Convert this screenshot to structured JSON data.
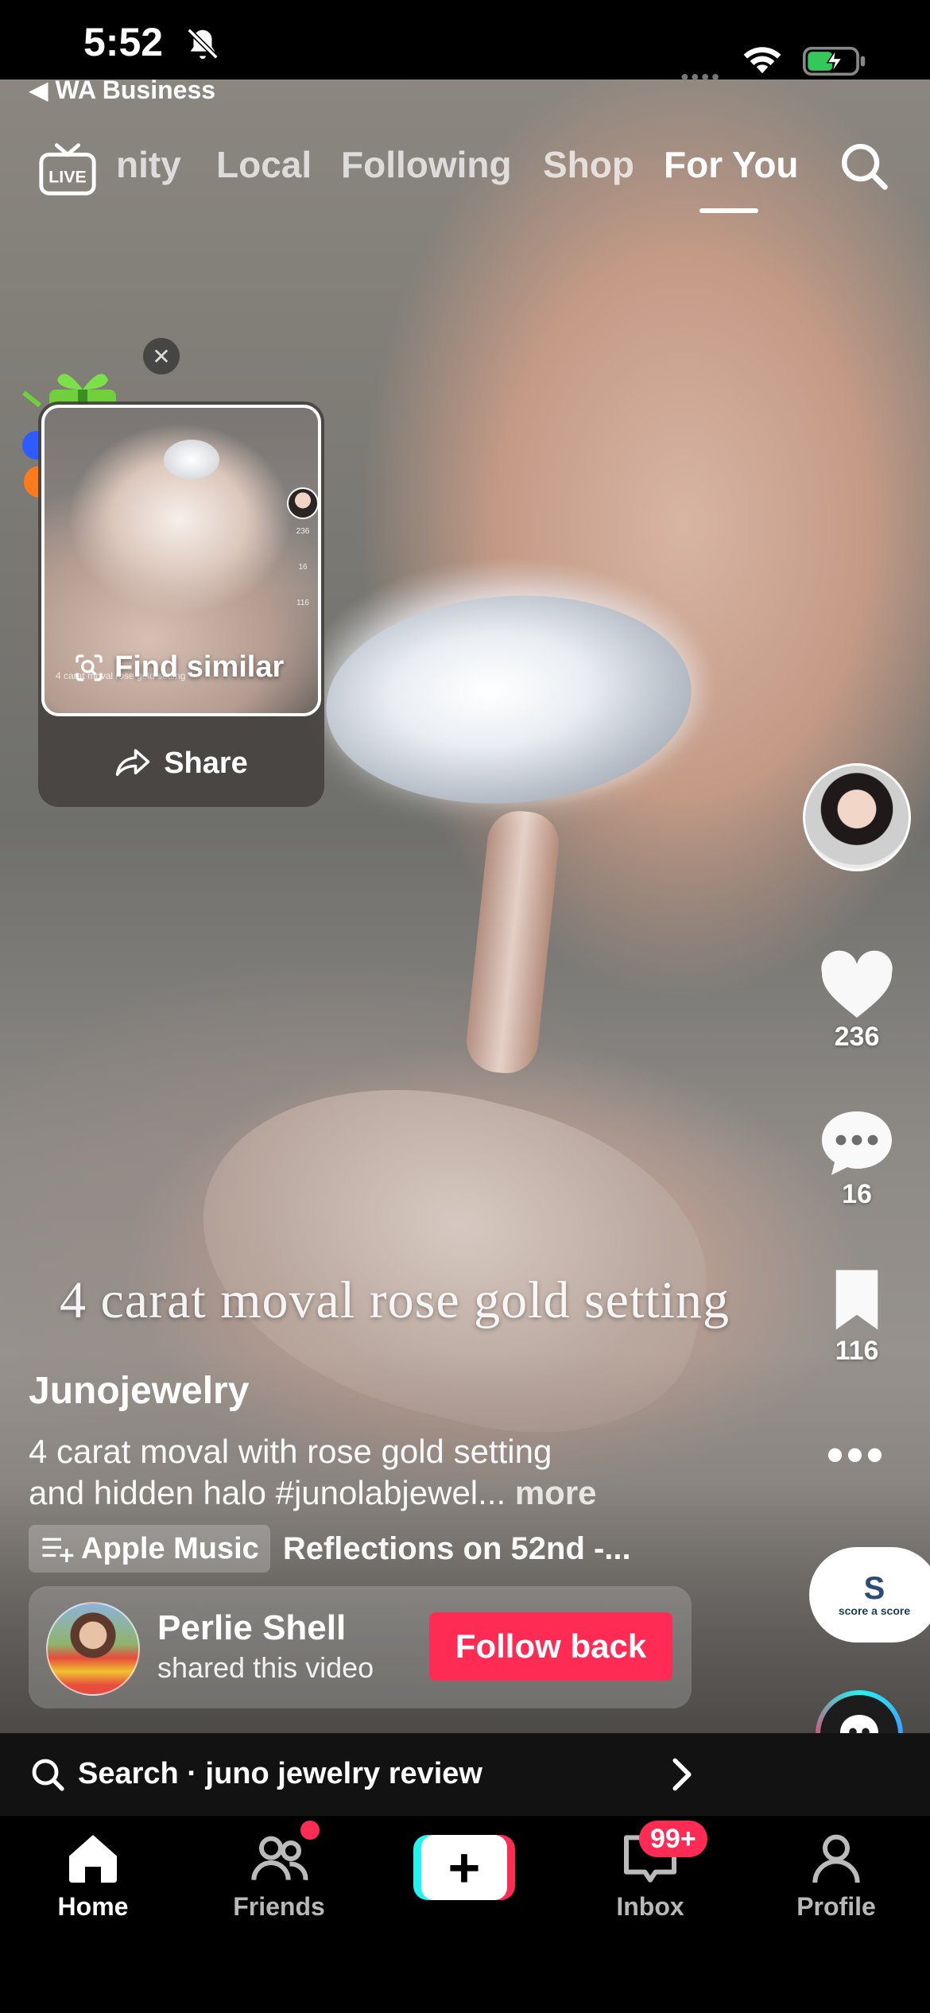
{
  "status_bar": {
    "time": "5:52"
  },
  "back_link": {
    "label": "◀ WA Business"
  },
  "top_nav": {
    "live_label": "LIVE",
    "tabs": [
      "nity",
      "Local",
      "Following",
      "Shop",
      "For You"
    ],
    "active_tab": "For You"
  },
  "video": {
    "overlay_text": "4 carat moval rose gold setting"
  },
  "mini_card": {
    "find_similar_label": "Find similar",
    "share_label": "Share",
    "thumb_likes": "236",
    "thumb_comments": "16",
    "thumb_saves": "116",
    "thumb_text": "4 carat moval rose gold setting"
  },
  "right_rail": {
    "likes": "236",
    "comments": "16",
    "saves": "116",
    "sound_label": "score a score"
  },
  "post": {
    "username": "Junojewelry",
    "caption_line1": "4 carat moval with rose gold setting",
    "caption_line2": "and hidden halo #junolabjewel...",
    "more_label": "more",
    "music_chip": "Apple Music",
    "music_title": "Reflections on 52nd -..."
  },
  "shared_by": {
    "name": "Perlie Shell",
    "subtitle": "shared this video",
    "button_label": "Follow back"
  },
  "search_strip": {
    "text": "Search · juno jewelry review"
  },
  "bottom_nav": {
    "home": "Home",
    "friends": "Friends",
    "inbox": "Inbox",
    "inbox_badge": "99+",
    "profile": "Profile"
  },
  "colors": {
    "accent_red": "#fe2c55",
    "accent_cyan": "#25f4ee",
    "battery_green": "#34c759"
  }
}
